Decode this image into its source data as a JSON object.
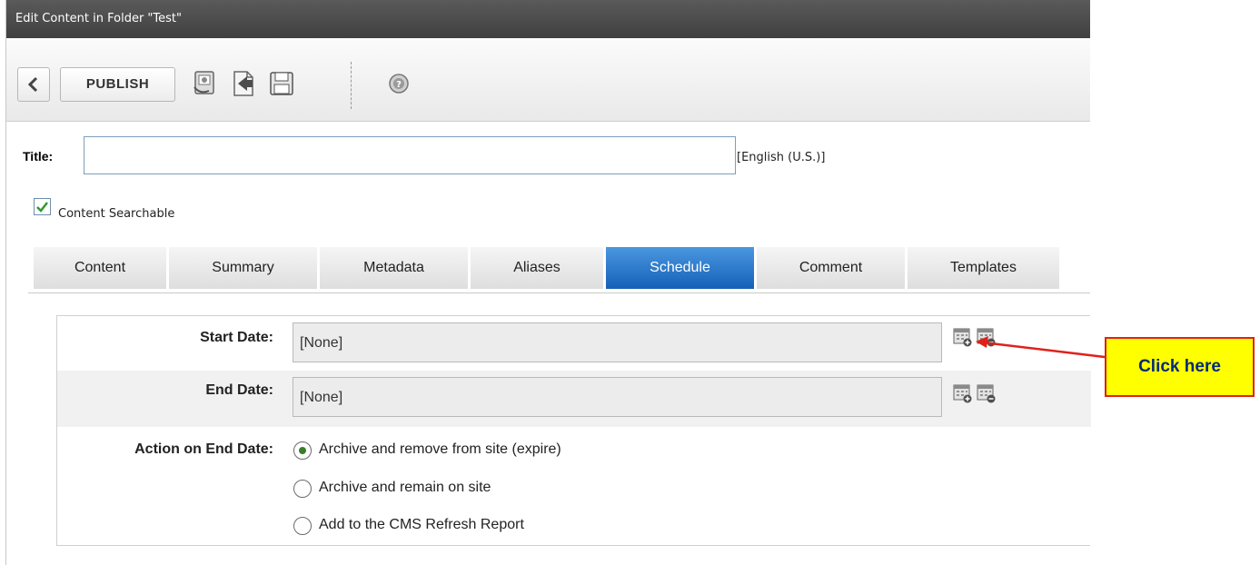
{
  "window": {
    "title": "Edit Content in Folder \"Test\""
  },
  "toolbar": {
    "publish_label": "PUBLISH",
    "icons": [
      "back-icon",
      "checkin-icon",
      "submit-icon",
      "save-icon",
      "help-icon"
    ]
  },
  "form": {
    "title_label": "Title:",
    "title_value": "",
    "language": "[English (U.S.)]",
    "searchable_label": "Content Searchable",
    "searchable_checked": true
  },
  "tabs": [
    {
      "label": "Content"
    },
    {
      "label": "Summary"
    },
    {
      "label": "Metadata"
    },
    {
      "label": "Aliases"
    },
    {
      "label": "Schedule",
      "active": true
    },
    {
      "label": "Comment"
    },
    {
      "label": "Templates"
    }
  ],
  "schedule": {
    "start_label": "Start Date:",
    "start_value": "[None]",
    "end_label": "End Date:",
    "end_value": "[None]",
    "action_label": "Action on End Date:",
    "options": [
      {
        "label": "Archive and remove from site (expire)",
        "selected": true
      },
      {
        "label": "Archive and remain on site",
        "selected": false
      },
      {
        "label": "Add to the CMS Refresh Report",
        "selected": false
      }
    ]
  },
  "annotation": {
    "text": "Click here"
  },
  "colors": {
    "accent": "#1a6cc8",
    "callout_bg": "#ffff00",
    "callout_border": "#e0211a"
  }
}
